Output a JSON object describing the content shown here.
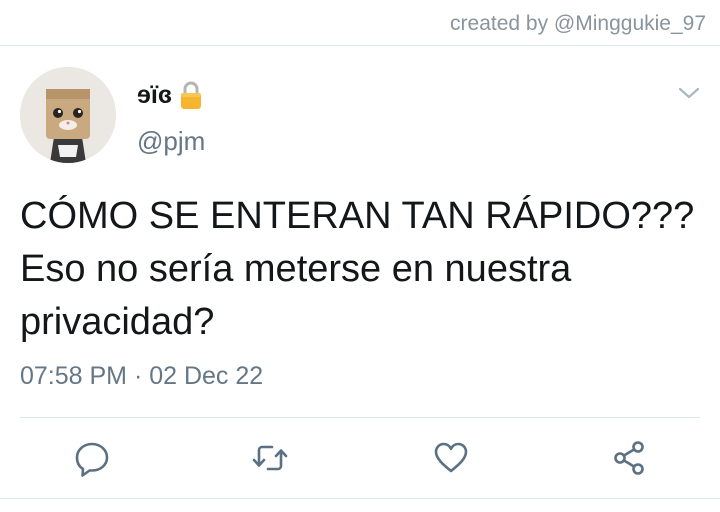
{
  "credit": {
    "text": "created by @Minggukie_97"
  },
  "tweet": {
    "display_name": "ɘïɞ",
    "handle": "@pjm",
    "text": "CÓMO SE ENTERAN TAN RÁPIDO??? Eso no sería meterse en nuestra privacidad?",
    "timestamp": "07:58 PM · 02 Dec 22"
  },
  "icons": {
    "lock": "lock-icon",
    "chevron": "chevron-down-icon",
    "reply": "reply-icon",
    "retweet": "retweet-icon",
    "like": "heart-icon",
    "share": "share-icon"
  },
  "colors": {
    "text": "#14171a",
    "secondary": "#657786",
    "icon": "#5b7083",
    "lock": "#f5b52e",
    "divider": "#e1e8ed"
  }
}
